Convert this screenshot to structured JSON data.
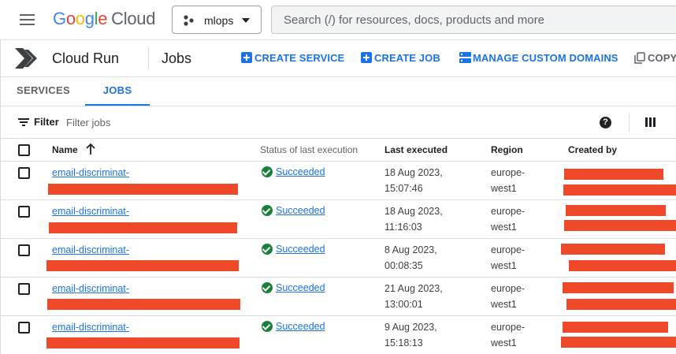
{
  "header": {
    "logo_google": [
      "G",
      "o",
      "o",
      "g",
      "l",
      "e"
    ],
    "logo_cloud": "Cloud",
    "project": "mlops",
    "search_placeholder": "Search (/) for resources, docs, products and more"
  },
  "productbar": {
    "product": "Cloud Run",
    "page": "Jobs",
    "actions": {
      "create_service": "CREATE SERVICE",
      "create_job": "CREATE JOB",
      "manage_domains": "MANAGE CUSTOM DOMAINS",
      "copy": "COPY"
    }
  },
  "tabs": [
    "SERVICES",
    "JOBS"
  ],
  "active_tab": "JOBS",
  "filter": {
    "label": "Filter",
    "placeholder": "Filter jobs"
  },
  "table": {
    "columns": {
      "name": "Name",
      "status": "Status of last execution",
      "last_executed": "Last executed",
      "region": "Region",
      "created_by": "Created by"
    },
    "rows": [
      {
        "name": "email-discriminat-",
        "status": "Succeeded",
        "date": "18 Aug 2023,",
        "time": "15:07:46",
        "region_1": "europe-",
        "region_2": "west1"
      },
      {
        "name": "email-discriminat-",
        "status": "Succeeded",
        "date": "18 Aug 2023,",
        "time": "11:16:03",
        "region_1": "europe-",
        "region_2": "west1"
      },
      {
        "name": "email-discriminat-",
        "status": "Succeeded",
        "date": "8 Aug 2023,",
        "time": "00:08:35",
        "region_1": "europe-",
        "region_2": "west1"
      },
      {
        "name": "email-discriminat-",
        "status": "Succeeded",
        "date": "21 Aug 2023,",
        "time": "13:00:01",
        "region_1": "europe-",
        "region_2": "west1"
      },
      {
        "name": "email-discriminat-",
        "status": "Succeeded",
        "date": "9 Aug 2023,",
        "time": "15:18:13",
        "region_1": "europe-",
        "region_2": "west1"
      }
    ]
  },
  "colors": {
    "accent": "#1a73e8",
    "success": "#188038",
    "redaction": "#ee4a2a"
  },
  "icons": [
    "menu-icon",
    "project-icon",
    "chevron-down-icon",
    "cloud-run-icon",
    "add-icon",
    "domains-icon",
    "copy-icon",
    "filter-icon",
    "help-icon",
    "columns-icon",
    "sort-up-icon",
    "check-circle-icon"
  ]
}
